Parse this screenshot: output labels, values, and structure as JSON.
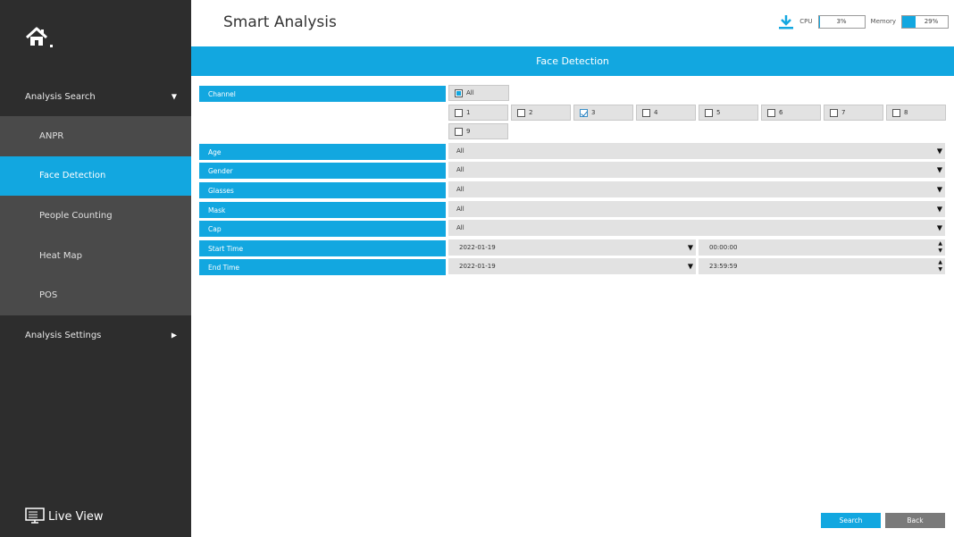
{
  "header": {
    "title": "Smart Analysis",
    "cpu_label": "CPU",
    "cpu_value": "3%",
    "cpu_fraction": 0.03,
    "memory_label": "Memory",
    "memory_value": "29%",
    "memory_fraction": 0.29
  },
  "sidebar": {
    "analysis_search": "Analysis Search",
    "items": [
      {
        "label": "ANPR"
      },
      {
        "label": "Face Detection"
      },
      {
        "label": "People Counting"
      },
      {
        "label": "Heat Map"
      },
      {
        "label": "POS"
      }
    ],
    "analysis_settings": "Analysis Settings",
    "live_view": "Live View"
  },
  "panel": {
    "title": "Face Detection",
    "channel_label": "Channel",
    "channel_all": "All",
    "channels": [
      "1",
      "2",
      "3",
      "4",
      "5",
      "6",
      "7",
      "8",
      "9"
    ],
    "checked_channel": "3",
    "age_label": "Age",
    "age_value": "All",
    "gender_label": "Gender",
    "gender_value": "All",
    "glasses_label": "Glasses",
    "glasses_value": "All",
    "mask_label": "Mask",
    "mask_value": "All",
    "cap_label": "Cap",
    "cap_value": "All",
    "start_time_label": "Start Time",
    "start_date": "2022-01-19",
    "start_time": "00:00:00",
    "end_time_label": "End Time",
    "end_date": "2022-01-19",
    "end_time": "23:59:59"
  },
  "buttons": {
    "search": "Search",
    "back": "Back"
  },
  "colors": {
    "accent": "#12a7e0",
    "sidebar_bg": "#2d2d2d",
    "sidebar_sub_bg": "#4a4a4a"
  }
}
